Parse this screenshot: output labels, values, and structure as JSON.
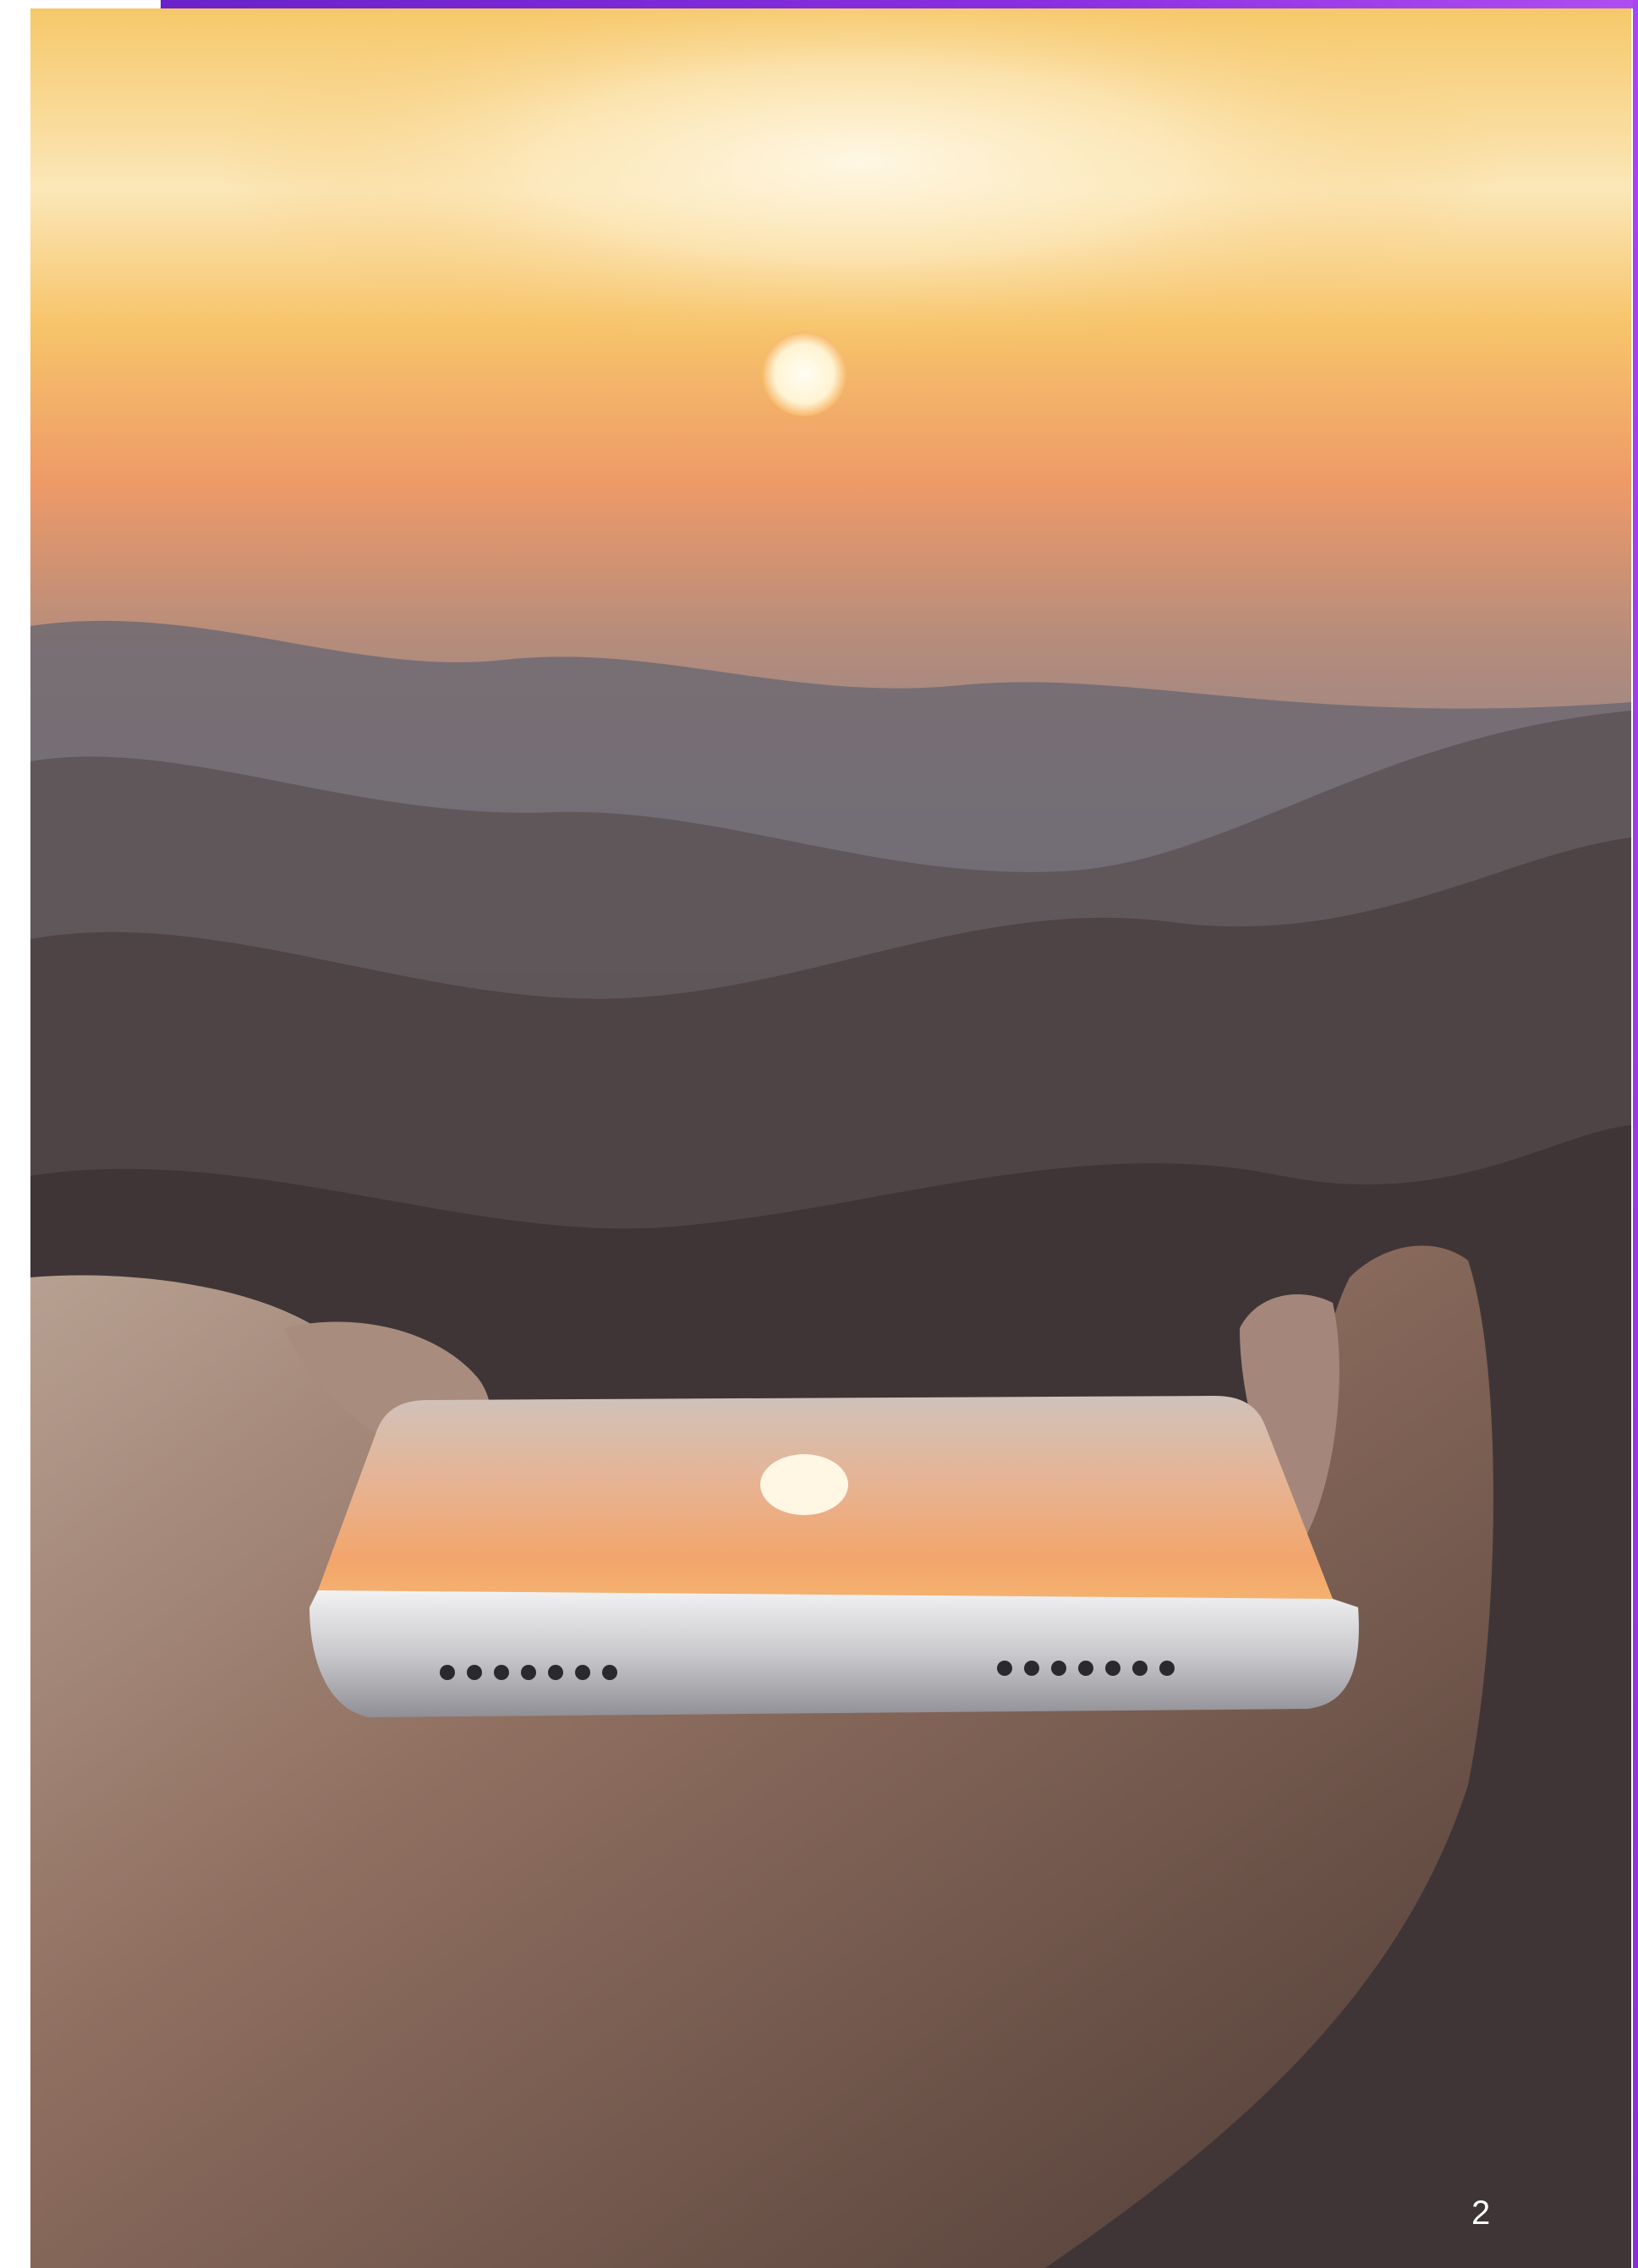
{
  "page": {
    "page_number": "2"
  },
  "photo": {
    "subject_icon": "sunset-phone-reflection-photo"
  },
  "colors": {
    "accent": "#8a2fe0",
    "accent_light": "#b04df0"
  }
}
